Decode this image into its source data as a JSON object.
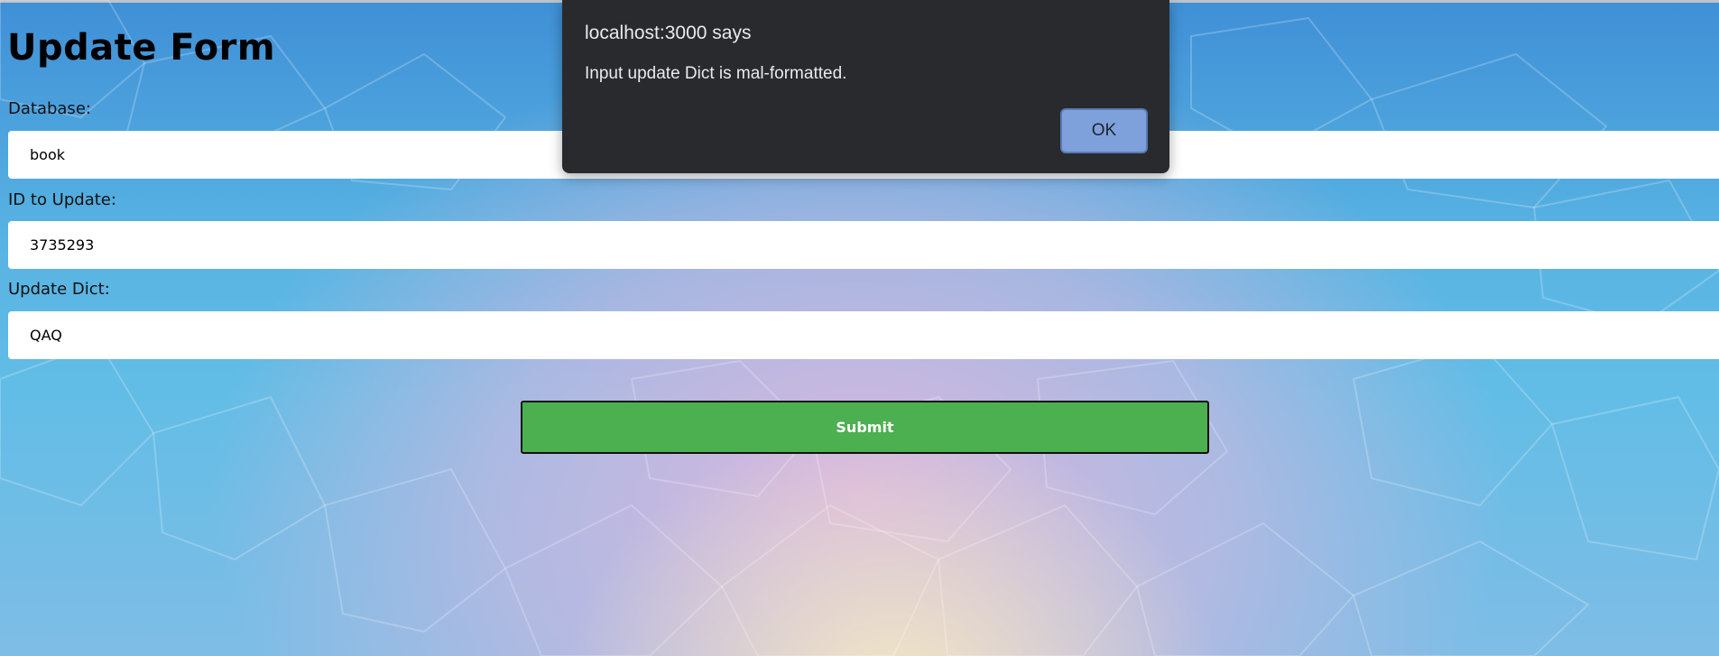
{
  "form": {
    "title": "Update Form",
    "database": {
      "label": "Database:",
      "value": "book"
    },
    "id_to_update": {
      "label": "ID to Update:",
      "value": "3735293"
    },
    "update_dict": {
      "label": "Update Dict:",
      "value": "QAQ"
    },
    "submit_label": "Submit"
  },
  "dialog": {
    "title": "localhost:3000 says",
    "message": "Input update Dict is mal-formatted.",
    "ok_label": "OK"
  },
  "colors": {
    "submit_bg": "#4caf50",
    "dialog_bg": "#292a2d",
    "ok_bg": "#7ea1dc"
  }
}
